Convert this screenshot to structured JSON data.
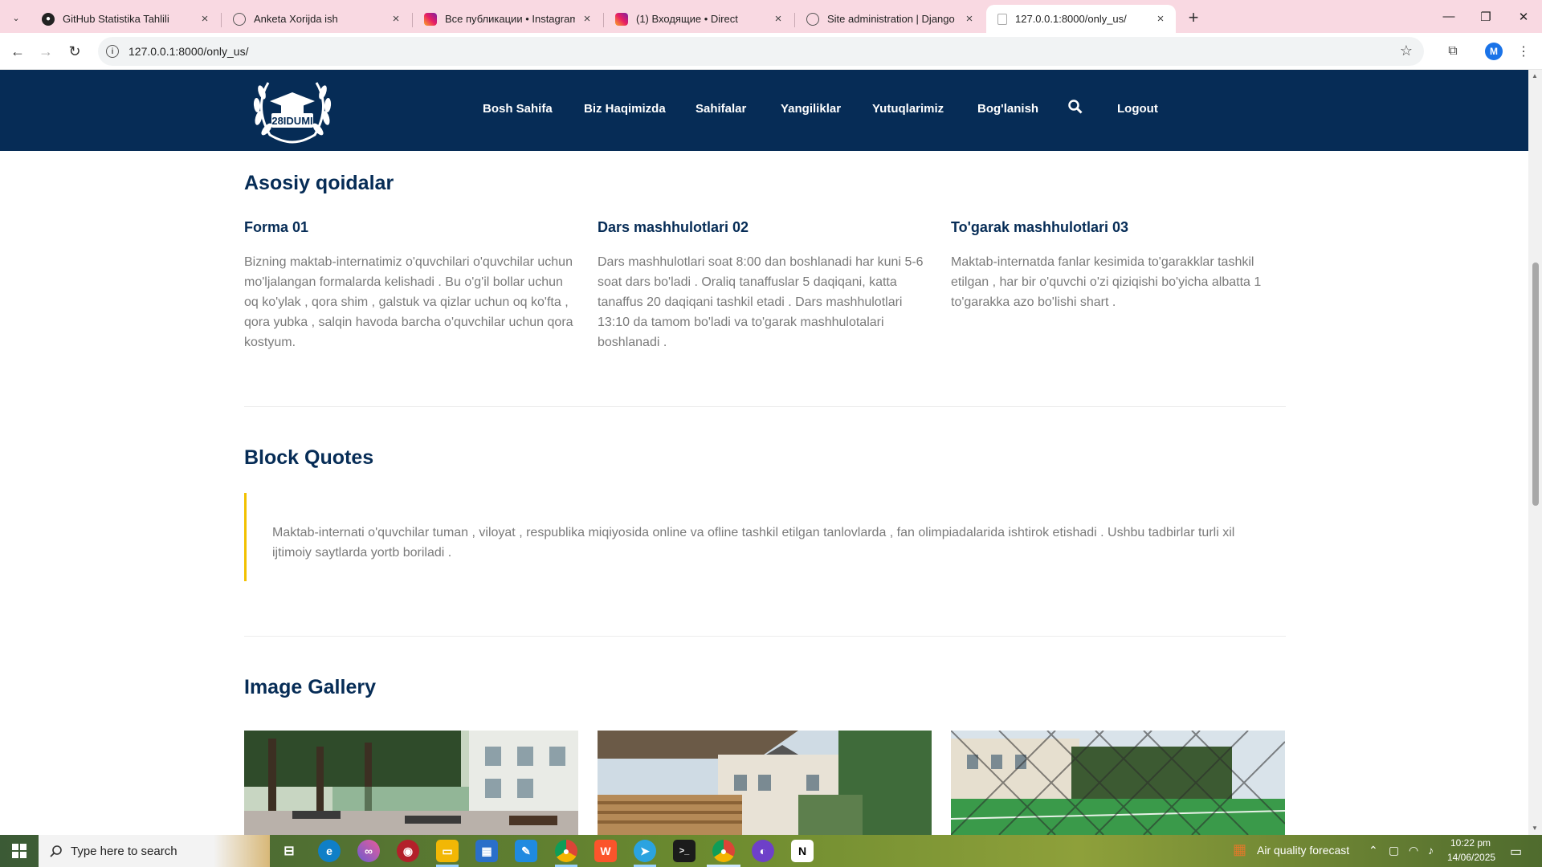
{
  "browser": {
    "tabs": [
      {
        "title": "GitHub Statistika Tahlili",
        "icon": "github-icon",
        "active": false
      },
      {
        "title": "Anketa Xorijda ish",
        "icon": "globe-icon",
        "active": false
      },
      {
        "title": "Все публикации • Instagram",
        "icon": "instagram-icon",
        "active": false
      },
      {
        "title": "(1) Входящие • Direct",
        "icon": "instagram-icon",
        "active": false
      },
      {
        "title": "Site administration | Django site",
        "icon": "globe-icon",
        "active": false
      },
      {
        "title": "127.0.0.1:8000/only_us/",
        "icon": "page-icon",
        "active": true
      }
    ],
    "url": "127.0.0.1:8000/only_us/",
    "profile_initial": "M"
  },
  "site": {
    "logo_text": "28IDUMI",
    "nav": [
      "Bosh Sahifa",
      "Biz Haqimizda",
      "Sahifalar",
      "Yangiliklar",
      "Yutuqlarimiz",
      "Bog'lanish",
      "Logout"
    ]
  },
  "rules": {
    "title": "Asosiy qoidalar",
    "columns": [
      {
        "title": "Forma 01",
        "lines": [
          "Bizning maktab-internatimiz o'quvchilari o'quvchilar uchun",
          "mo'ljalangan formalarda kelishadi . Bu o'g'il bollar uchun",
          "oq ko'ylak , qora shim , galstuk va qizlar uchun oq ko'fta ,",
          "qora yubka , salqin havoda barcha o'quvchilar uchun qora",
          "kostyum."
        ]
      },
      {
        "title": "Dars mashhulotlari 02",
        "lines": [
          "Dars mashhulotlari soat 8:00 dan boshlanadi har kuni 5-6",
          "soat dars bo'ladi . Oraliq tanaffuslar 5 daqiqani, katta",
          "tanaffus 20 daqiqani tashkil etadi . Dars mashhulotlari",
          "13:10 da tamom bo'ladi va to'garak mashhulotalari",
          "boshlanadi ."
        ]
      },
      {
        "title": "To'garak mashhulotlari 03",
        "lines": [
          "Maktab-internatda fanlar kesimida to'garakklar tashkil",
          "etilgan , har bir o'quvchi o'zi qiziqishi bo'yicha albatta 1",
          "to'garakka azo bo'lishi shart ."
        ]
      }
    ]
  },
  "quotes": {
    "title": "Block Quotes",
    "lines": [
      "Maktab-internati o'quvchilar tuman , viloyat , respublika miqiyosida online va ofline tashkil etilgan tanlovlarda , fan olimpiadalarida ishtirok etishadi . Ushbu tadbirlar turli xil",
      "ijtimoiy saytlarda yortb boriladi ."
    ]
  },
  "gallery": {
    "title": "Image Gallery",
    "images": [
      "school-courtyard-photo",
      "school-stands-photo",
      "school-football-field-photo"
    ]
  },
  "taskbar": {
    "search_placeholder": "Type here to search",
    "weather": "Air quality forecast",
    "time": "10:22 pm",
    "date": "14/06/2025"
  }
}
